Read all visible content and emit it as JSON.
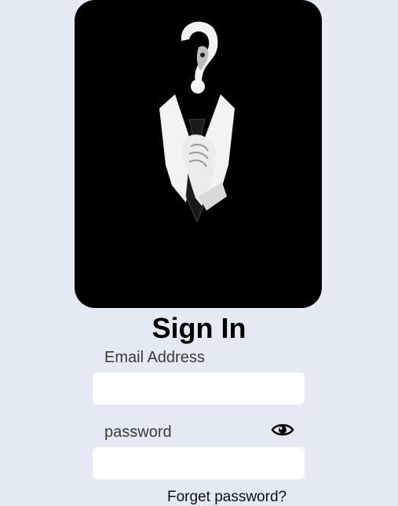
{
  "hero": {
    "image": "anonymous-question-mark-suit-illustration"
  },
  "form": {
    "title": "Sign In",
    "email_label": "Email Address",
    "email_value": "",
    "password_label": "password",
    "password_value": "",
    "password_toggle_icon": "eye-icon",
    "forgot_link": "Forget password?"
  },
  "colors": {
    "background": "#e3eaf3",
    "hero_background": "#000000",
    "input_background": "#ffffff"
  }
}
